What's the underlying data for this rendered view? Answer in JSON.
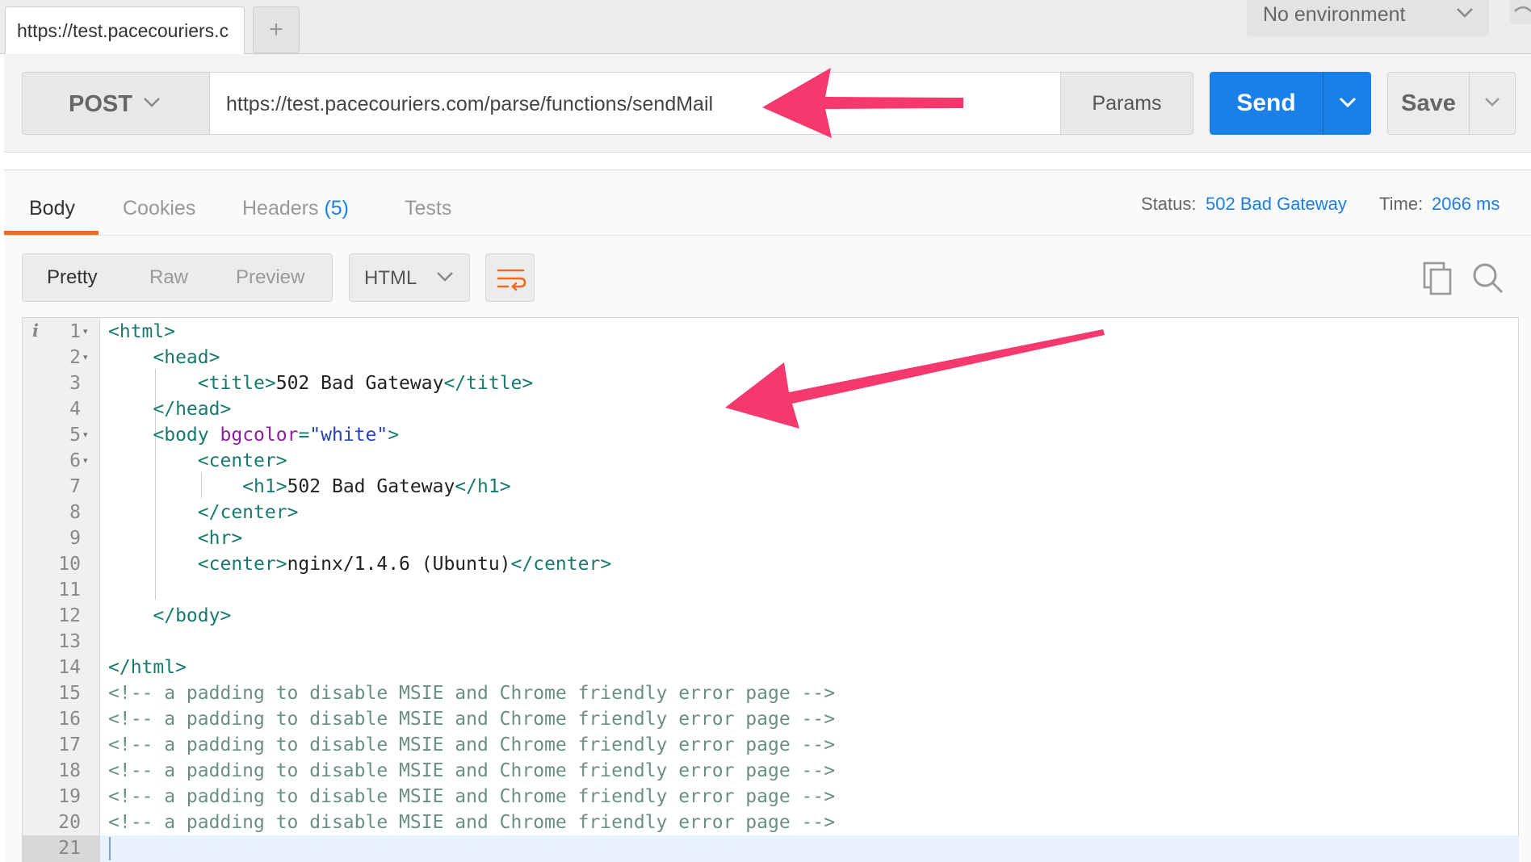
{
  "tabs": {
    "active_url": "https://test.pacecouriers.c",
    "new_tab": "+"
  },
  "environment": {
    "selected": "No environment"
  },
  "request": {
    "method": "POST",
    "url": "https://test.pacecouriers.com/parse/functions/sendMail",
    "params_label": "Params",
    "send_label": "Send",
    "save_label": "Save"
  },
  "response": {
    "tabs": [
      {
        "label": "Body"
      },
      {
        "label": "Cookies"
      },
      {
        "label": "Headers",
        "count": "(5)"
      },
      {
        "label": "Tests"
      }
    ],
    "status_label": "Status:",
    "status_value": "502 Bad Gateway",
    "time_label": "Time:",
    "time_value": "2066 ms",
    "views": [
      "Pretty",
      "Raw",
      "Preview"
    ],
    "format": "HTML"
  },
  "editor": {
    "info_marker": "i",
    "line_numbers": [
      "1",
      "2",
      "3",
      "4",
      "5",
      "6",
      "7",
      "8",
      "9",
      "10",
      "11",
      "12",
      "13",
      "14",
      "15",
      "16",
      "17",
      "18",
      "19",
      "20",
      "21"
    ],
    "lines": [
      "<html>",
      "    <head>",
      "        <title>502 Bad Gateway</title>",
      "    </head>",
      "    <body bgcolor=\"white\">",
      "        <center>",
      "            <h1>502 Bad Gateway</h1>",
      "        </center>",
      "        <hr>",
      "        <center>nginx/1.4.6 (Ubuntu)</center>",
      "",
      "    </body>",
      "",
      "</html>",
      "<!-- a padding to disable MSIE and Chrome friendly error page -->",
      "<!-- a padding to disable MSIE and Chrome friendly error page -->",
      "<!-- a padding to disable MSIE and Chrome friendly error page -->",
      "<!-- a padding to disable MSIE and Chrome friendly error page -->",
      "<!-- a padding to disable MSIE and Chrome friendly error page -->",
      "<!-- a padding to disable MSIE and Chrome friendly error page -->",
      ""
    ]
  },
  "colors": {
    "accent_blue": "#1a7fe6",
    "tab_underline": "#f26b1d",
    "annotation_arrow": "#f5386e"
  }
}
